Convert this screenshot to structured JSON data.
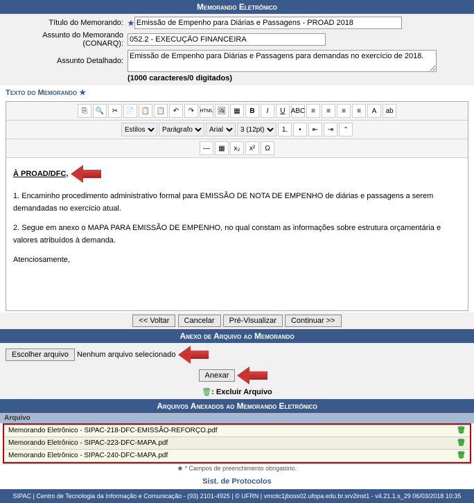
{
  "header": "Memorando Eletrônico",
  "labels": {
    "titulo": "Título do Memorando:",
    "assunto": "Assunto do Memorando (CONARQ):",
    "detalhado": "Assunto Detalhado:"
  },
  "fields": {
    "titulo": "Emissão de Empenho para Diárias e Passagens - PROAD 2018",
    "assunto": "052.2 - EXECUÇÃO FINANCEIRA",
    "detalhado": "Emissão de Empenho para Diárias e Passagens para demandas no exercício de 2018."
  },
  "counter": "(1000 caracteres/0 digitados)",
  "texto_label": "Texto do Memorando ",
  "toolbar": {
    "estilos": "Estilos",
    "paragrafo": "Parágrafo",
    "fonte": "Arial",
    "tamanho": "3 (12pt)"
  },
  "body": {
    "dest": "À PROAD/DFC,",
    "p1": "1. Encaminho procedimento administrativo formal para EMISSÃO DE NOTA DE EMPENHO de diárias e passagens a serem demandadas no exercício atual.",
    "p2": "2. Segue em anexo o MAPA PARA EMISSÃO DE EMPENHO, no qual constam as informações sobre estrutura orçamentária e valores atribuídos à demanda.",
    "p3": "Atenciosamente,"
  },
  "buttons": {
    "voltar": "<< Voltar",
    "cancelar": "Cancelar",
    "previsualizar": "Pré-Visualizar",
    "continuar": "Continuar >>",
    "escolher": "Escolher arquivo",
    "nenhum": "Nenhum arquivo selecionado",
    "anexar": "Anexar",
    "excluir": ": Excluir Arquivo"
  },
  "anexo_header": "Anexo de Arquivo ao Memorando",
  "arquivos_header": "Arquivos Anexados ao Memorando Eletrônico",
  "arquivo_col": "Arquivo",
  "files": [
    "Memorando Eletrônico - SIPAC-218-DFC-EMISSÃO-REFORÇO.pdf",
    "Memorando Eletrônico - SIPAC-223-DFC-MAPA.pdf",
    "Memorando Eletrônico - SIPAC-240-DFC-MAPA.pdf"
  ],
  "obrig": "* Campos de preenchimento obrigatório.",
  "sist": "Sist. de Protocolos",
  "footer": "SIPAC | Centro de Tecnologia da Informação e Comunicação - (93) 2101-4925 | © UFRN | vmctic1jboss02.ufopa.edu.br.srv2inst1 - v4.21.1.s_29 06/03/2018 10:35"
}
